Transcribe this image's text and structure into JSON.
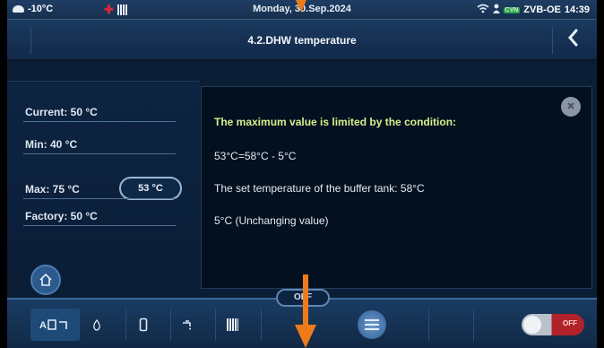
{
  "status_bar": {
    "temperature": "-10°C",
    "date": "Monday, 30.Sep.2024",
    "device": "ZVB-OE",
    "badge": "CVN",
    "time": "14:39"
  },
  "header": {
    "title": "4.2.DHW temperature"
  },
  "info": {
    "current": "Current: 50 °C",
    "min": "Min: 40 °C",
    "max": "Max: 75 °C",
    "factory": "Factory: 50 °C",
    "value_button": "53 °C"
  },
  "message": {
    "heading": "The maximum value is limited by the condition:",
    "formula": "53°C=58°C - 5°C",
    "buffer": "The set temperature of the buffer tank: 58°C",
    "constant": "5°C (Unchanging value)"
  },
  "bottom_bar": {
    "mode_label": "OFF",
    "power_label": "OFF"
  },
  "colors": {
    "background": "#0b1d33",
    "accent_text": "#d6ef8d",
    "arrow": "#ef7a1a",
    "power_off": "#b2222a"
  }
}
